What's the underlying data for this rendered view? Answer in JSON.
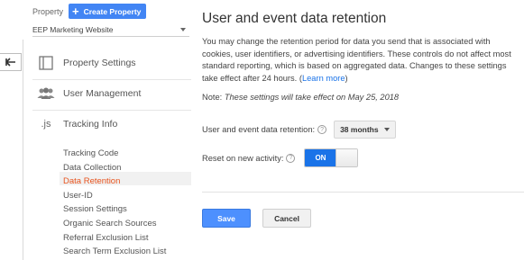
{
  "header": {
    "property_label": "Property",
    "create_button": "Create Property",
    "selected_property": "EEP Marketing Website"
  },
  "sidebar": {
    "items": [
      {
        "label": "Property Settings",
        "icon": "property-settings-icon"
      },
      {
        "label": "User Management",
        "icon": "users-icon"
      },
      {
        "label": "Tracking Info",
        "icon": "js-icon",
        "icon_text": ".js"
      }
    ],
    "sub_items": [
      {
        "label": "Tracking Code",
        "active": false
      },
      {
        "label": "Data Collection",
        "active": false
      },
      {
        "label": "Data Retention",
        "active": true
      },
      {
        "label": "User-ID",
        "active": false
      },
      {
        "label": "Session Settings",
        "active": false
      },
      {
        "label": "Organic Search Sources",
        "active": false
      },
      {
        "label": "Referral Exclusion List",
        "active": false
      },
      {
        "label": "Search Term Exclusion List",
        "active": false
      }
    ]
  },
  "main": {
    "title": "User and event data retention",
    "description": "You may change the retention period for data you send that is associated with cookies, user identifiers, or advertising identifiers. These controls do not affect most standard reporting, which is based on aggregated data. Changes to these settings take effect after 24 hours.",
    "learn_more_open": "(",
    "learn_more": "Learn more",
    "learn_more_close": ")",
    "note_prefix": "Note: ",
    "note_text": "These settings will take effect on May 25, 2018",
    "retention_label": "User and event data retention:",
    "retention_value": "38 months",
    "reset_label": "Reset on new activity:",
    "reset_value": "ON",
    "help_glyph": "?",
    "save_label": "Save",
    "cancel_label": "Cancel"
  },
  "colors": {
    "accent_blue": "#4285f4",
    "active_orange": "#e8541e",
    "toggle_on": "#1a73e8"
  }
}
